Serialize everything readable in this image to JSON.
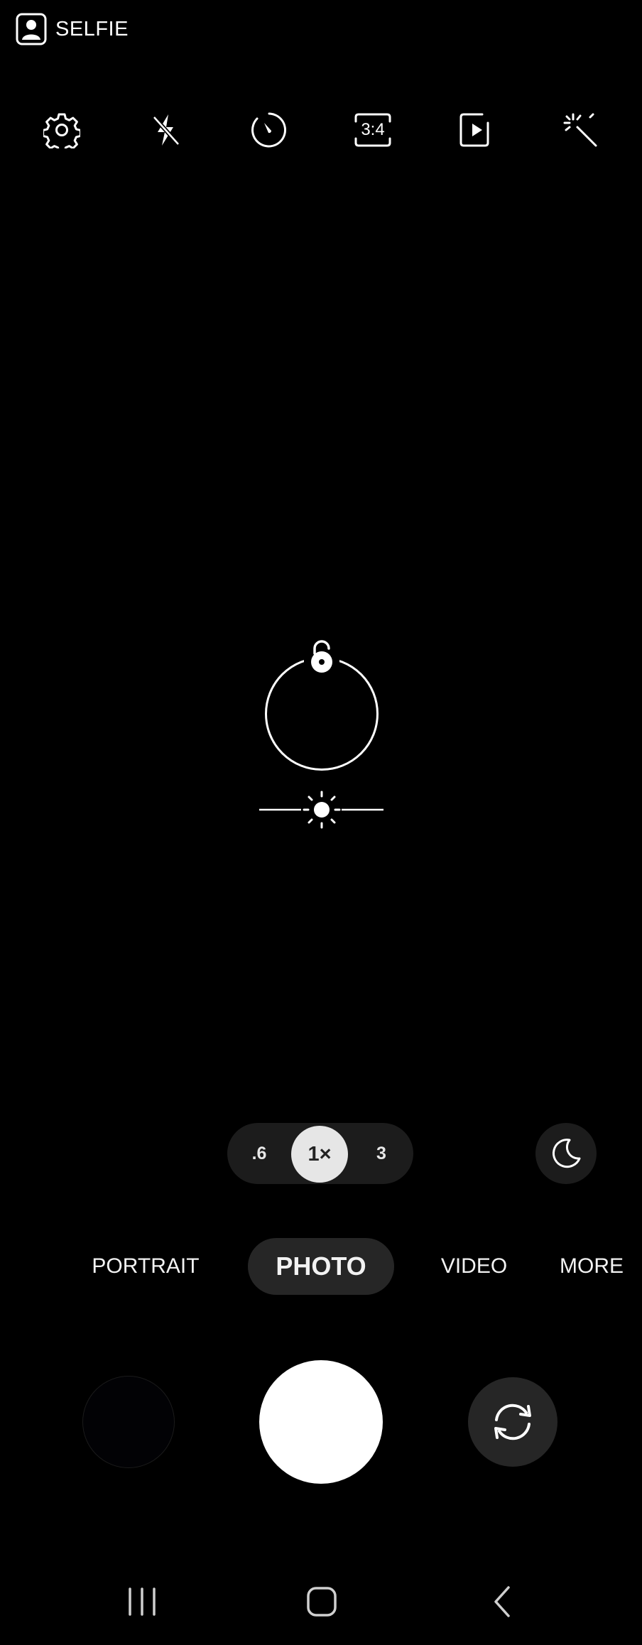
{
  "status": {
    "camera_label": "SELFIE",
    "icon": "selfie-person-icon"
  },
  "toolbar": {
    "icons": [
      "settings-gear-icon",
      "flash-off-icon",
      "timer-icon",
      "aspect-ratio-icon",
      "motion-photo-icon",
      "effects-wand-icon"
    ],
    "aspect_ratio_label": "3:4"
  },
  "focus": {
    "lock_icon": "unlock-icon",
    "exposure_icon": "sun-icon"
  },
  "zoom": {
    "options": [
      ".6",
      "1×",
      "3"
    ],
    "selected": "1×"
  },
  "night_mode_icon": "moon-icon",
  "modes": {
    "items": [
      "PORTRAIT",
      "PHOTO",
      "VIDEO",
      "MORE"
    ],
    "selected": "PHOTO"
  },
  "controls": {
    "flip_icon": "switch-camera-icon"
  },
  "system_nav": [
    "recents-icon",
    "home-icon",
    "back-icon"
  ],
  "colors": {
    "background": "#000000",
    "pill": "#1c1c1c",
    "selected_zoom": "#e6e6e6",
    "foreground": "#ffffff"
  }
}
